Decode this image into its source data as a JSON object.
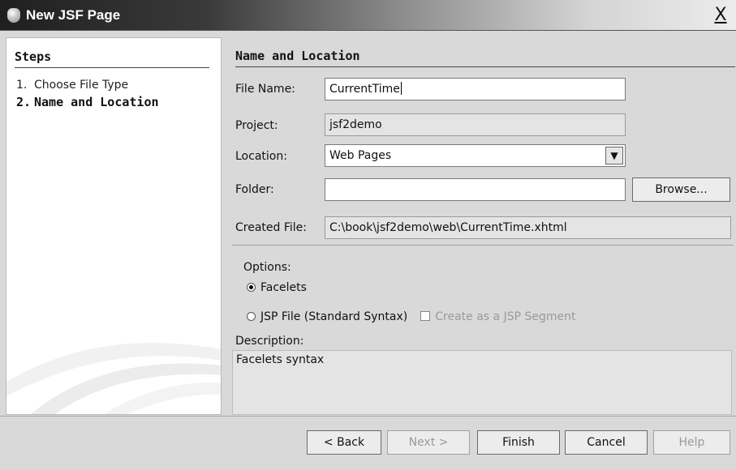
{
  "window": {
    "title": "New JSF Page",
    "close_label": "X"
  },
  "steps": {
    "heading": "Steps",
    "items": [
      {
        "num": "1.",
        "label": "Choose File Type"
      },
      {
        "num": "2.",
        "label": "Name and Location"
      }
    ]
  },
  "main": {
    "heading": "Name and Location",
    "file_name": {
      "label": "File Name:",
      "value": "CurrentTime"
    },
    "project": {
      "label": "Project:",
      "value": "jsf2demo"
    },
    "location": {
      "label": "Location:",
      "value": "Web Pages"
    },
    "folder": {
      "label": "Folder:",
      "value": ""
    },
    "browse_label": "Browse...",
    "created_file": {
      "label": "Created File:",
      "value": "C:\\book\\jsf2demo\\web\\CurrentTime.xhtml"
    },
    "options_label": "Options:",
    "option_facelets": "Facelets",
    "option_jsp": "JSP File (Standard Syntax)",
    "checkbox_jsp_segment": "Create as a JSP Segment",
    "description_label": "Description:",
    "description_value": "Facelets syntax"
  },
  "footer": {
    "back": "< Back",
    "next": "Next >",
    "finish": "Finish",
    "cancel": "Cancel",
    "help": "Help"
  },
  "icons": {
    "window_icon": "coffee-bean-icon",
    "combo_arrow": "chevron-down-icon"
  }
}
